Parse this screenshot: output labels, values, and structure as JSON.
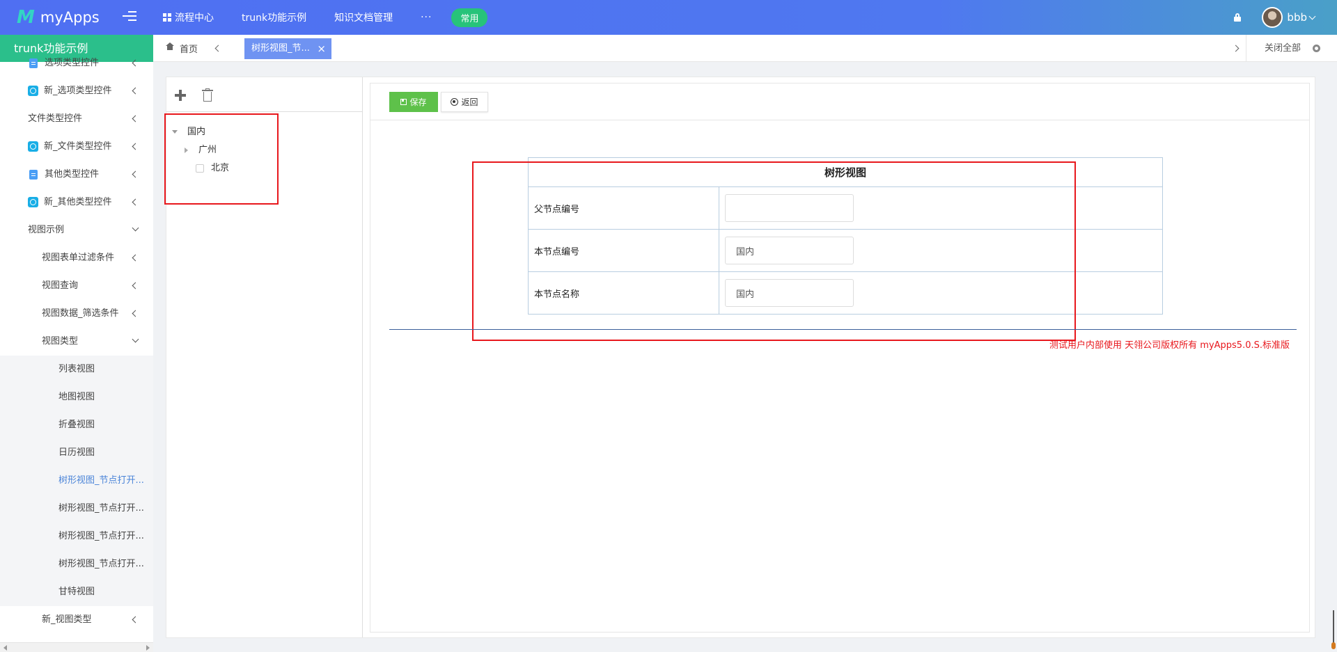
{
  "app": {
    "logo_mark": "M",
    "name": "myApps"
  },
  "nav": {
    "items": [
      {
        "label": "流程中心"
      },
      {
        "label": "trunk功能示例"
      },
      {
        "label": "知识文档管理"
      }
    ],
    "more": "···",
    "pill": "常用"
  },
  "user": {
    "name": "bbb"
  },
  "sidebar": {
    "title": "trunk功能示例",
    "items": [
      {
        "label": "选项类型控件",
        "icon": "doc-icon"
      },
      {
        "label": "新_选项类型控件",
        "icon": "app-icon"
      },
      {
        "label": "文件类型控件",
        "icon": ""
      },
      {
        "label": "新_文件类型控件",
        "icon": "app-icon"
      },
      {
        "label": "其他类型控件",
        "icon": "doc-icon"
      },
      {
        "label": "新_其他类型控件",
        "icon": "app-icon"
      },
      {
        "label": "视图示例"
      },
      {
        "label": "视图表单过滤条件"
      },
      {
        "label": "视图查询"
      },
      {
        "label": "视图数据_筛选条件"
      },
      {
        "label": "视图类型"
      },
      {
        "label": "列表视图"
      },
      {
        "label": "地图视图"
      },
      {
        "label": "折叠视图"
      },
      {
        "label": "日历视图"
      },
      {
        "label": "树形视图_节点打开..."
      },
      {
        "label": "树形视图_节点打开..."
      },
      {
        "label": "树形视图_节点打开..."
      },
      {
        "label": "树形视图_节点打开..."
      },
      {
        "label": "甘特视图"
      },
      {
        "label": "新_视图类型"
      }
    ]
  },
  "tabs": {
    "home": "首页",
    "active": "树形视图_节...",
    "close_glyph": "×",
    "close_all": "关闭全部"
  },
  "tree": {
    "root": "国内",
    "children": [
      "广州",
      "北京"
    ]
  },
  "form": {
    "save": "保存",
    "back": "返回",
    "title": "树形视图",
    "rows": [
      {
        "label": "父节点编号",
        "value": ""
      },
      {
        "label": "本节点编号",
        "value": "国内"
      },
      {
        "label": "本节点名称",
        "value": "国内"
      }
    ],
    "copyright": "测试用户内部使用 天翎公司版权所有 myApps5.0.S.标准版"
  },
  "colors": {
    "topbar": "#4f6ff2",
    "sidebar_head": "#2bbf8b",
    "active_tab": "#6f93f2",
    "save_button": "#5ec14a",
    "highlight_box": "#e8171c",
    "active_link": "#4a84d8"
  }
}
